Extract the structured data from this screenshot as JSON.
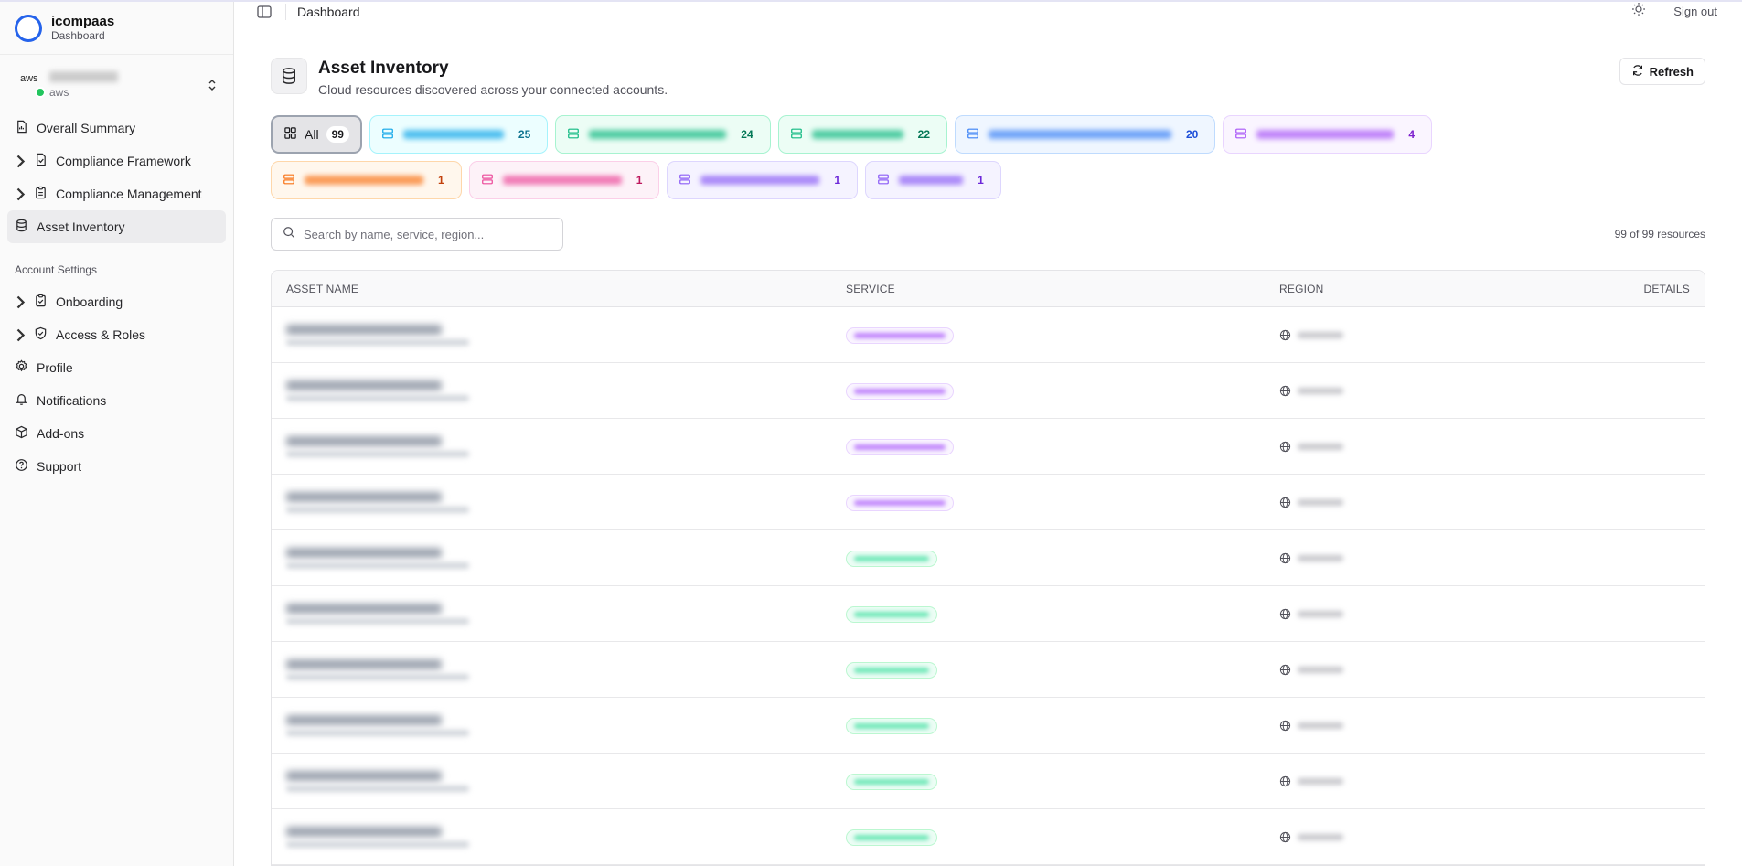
{
  "brand": {
    "name": "icompaas",
    "subtitle": "Dashboard"
  },
  "account": {
    "type": "aws",
    "logo_text": "aws"
  },
  "nav": {
    "items": [
      {
        "label": "Overall Summary",
        "icon": "report-icon",
        "caret": false,
        "active": false
      },
      {
        "label": "Compliance Framework",
        "icon": "file-check-icon",
        "caret": true,
        "active": false
      },
      {
        "label": "Compliance Management",
        "icon": "clipboard-icon",
        "caret": true,
        "active": false
      },
      {
        "label": "Asset Inventory",
        "icon": "database-icon",
        "caret": false,
        "active": true
      }
    ],
    "section_label": "Account Settings",
    "settings_items": [
      {
        "label": "Onboarding",
        "icon": "clipboard-check-icon",
        "caret": true
      },
      {
        "label": "Access & Roles",
        "icon": "shield-check-icon",
        "caret": true
      },
      {
        "label": "Profile",
        "icon": "gear-icon",
        "caret": false
      },
      {
        "label": "Notifications",
        "icon": "bell-icon",
        "caret": false
      },
      {
        "label": "Add-ons",
        "icon": "package-icon",
        "caret": false
      },
      {
        "label": "Support",
        "icon": "help-circle-icon",
        "caret": false
      }
    ]
  },
  "topbar": {
    "breadcrumb": "Dashboard",
    "signout_label": "Sign out"
  },
  "page": {
    "title": "Asset Inventory",
    "subtitle": "Cloud resources discovered across your connected accounts.",
    "refresh_label": "Refresh"
  },
  "filters": {
    "all": {
      "label": "All",
      "count": "99"
    },
    "chips": [
      {
        "count": "25",
        "color": "#0ea5e9",
        "bg": "#ecfeff",
        "border": "#a5f3fc",
        "fg": "#0e7490"
      },
      {
        "count": "24",
        "color": "#10b981",
        "bg": "#ecfdf5",
        "border": "#a7f3d0",
        "fg": "#047857"
      },
      {
        "count": "22",
        "color": "#10b981",
        "bg": "#ecfdf5",
        "border": "#a7f3d0",
        "fg": "#047857"
      },
      {
        "count": "20",
        "color": "#3b82f6",
        "bg": "#eff6ff",
        "border": "#bfdbfe",
        "fg": "#1d4ed8"
      },
      {
        "count": "4",
        "color": "#a855f7",
        "bg": "#faf5ff",
        "border": "#e9d5ff",
        "fg": "#7e22ce"
      },
      {
        "count": "1",
        "color": "#f97316",
        "bg": "#fff7ed",
        "border": "#fed7aa",
        "fg": "#c2410c"
      },
      {
        "count": "1",
        "color": "#ec4899",
        "bg": "#fdf2f8",
        "border": "#fbcfe8",
        "fg": "#be185d"
      },
      {
        "count": "1",
        "color": "#8b5cf6",
        "bg": "#f5f3ff",
        "border": "#ddd6fe",
        "fg": "#6d28d9"
      },
      {
        "count": "1",
        "color": "#8b5cf6",
        "bg": "#f5f3ff",
        "border": "#ddd6fe",
        "fg": "#6d28d9"
      }
    ]
  },
  "search": {
    "placeholder": "Search by name, service, region..."
  },
  "resource_count": "99 of 99 resources",
  "table": {
    "headers": {
      "name": "ASSET NAME",
      "service": "SERVICE",
      "region": "REGION",
      "details": "DETAILS"
    },
    "rows": [
      {
        "service_tone": "purple"
      },
      {
        "service_tone": "purple"
      },
      {
        "service_tone": "purple"
      },
      {
        "service_tone": "purple"
      },
      {
        "service_tone": "green"
      },
      {
        "service_tone": "green"
      },
      {
        "service_tone": "green"
      },
      {
        "service_tone": "green"
      },
      {
        "service_tone": "green"
      },
      {
        "service_tone": "green"
      }
    ]
  }
}
